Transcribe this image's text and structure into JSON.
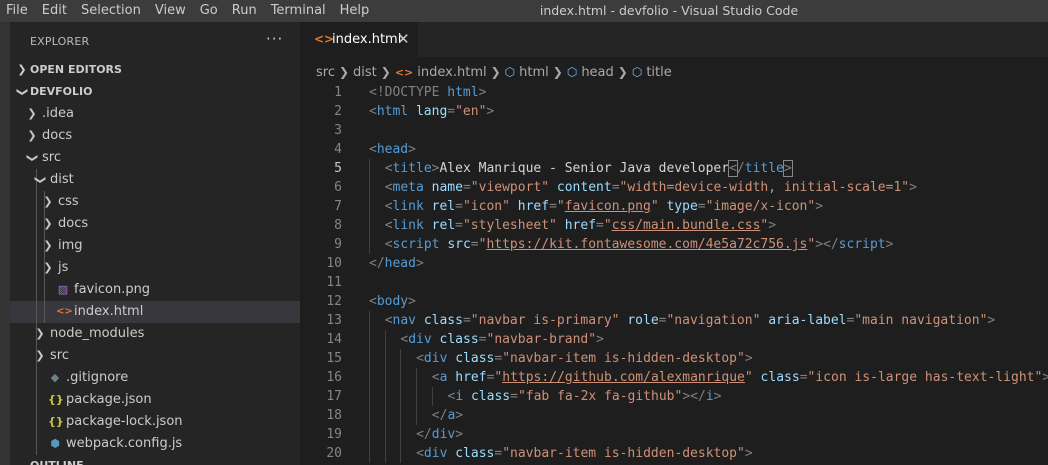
{
  "window": {
    "title": "index.html - devfolio - Visual Studio Code",
    "menu": [
      "File",
      "Edit",
      "Selection",
      "View",
      "Go",
      "Run",
      "Terminal",
      "Help"
    ]
  },
  "sidebar": {
    "title": "EXPLORER",
    "more": "···",
    "open_editors": "OPEN EDITORS",
    "project": "DEVFOLIO",
    "tree": [
      {
        "label": ".idea",
        "depth": 1,
        "kind": "folder",
        "expanded": false
      },
      {
        "label": "docs",
        "depth": 1,
        "kind": "folder",
        "expanded": false
      },
      {
        "label": "src",
        "depth": 1,
        "kind": "folder",
        "expanded": true
      },
      {
        "label": "dist",
        "depth": 2,
        "kind": "folder",
        "expanded": true
      },
      {
        "label": "css",
        "depth": 3,
        "kind": "folder",
        "expanded": false
      },
      {
        "label": "docs",
        "depth": 3,
        "kind": "folder",
        "expanded": false
      },
      {
        "label": "img",
        "depth": 3,
        "kind": "folder",
        "expanded": false
      },
      {
        "label": "js",
        "depth": 3,
        "kind": "folder",
        "expanded": false
      },
      {
        "label": "favicon.png",
        "depth": 3,
        "kind": "image"
      },
      {
        "label": "index.html",
        "depth": 3,
        "kind": "html",
        "selected": true
      },
      {
        "label": "node_modules",
        "depth": 2,
        "kind": "folder",
        "expanded": false
      },
      {
        "label": "src",
        "depth": 2,
        "kind": "folder",
        "expanded": false
      },
      {
        "label": ".gitignore",
        "depth": 2,
        "kind": "git"
      },
      {
        "label": "package.json",
        "depth": 2,
        "kind": "json"
      },
      {
        "label": "package-lock.json",
        "depth": 2,
        "kind": "json"
      },
      {
        "label": "webpack.config.js",
        "depth": 2,
        "kind": "webpack"
      }
    ],
    "outline_cut": "OUTLINE"
  },
  "editor": {
    "tab": {
      "label": "index.html",
      "close": "✕"
    },
    "breadcrumb": [
      "src",
      "dist",
      "index.html",
      "html",
      "head",
      "title"
    ],
    "lines": [
      {
        "n": "1",
        "indent": 0,
        "tokens": [
          [
            "t",
            "<!DOCTYPE "
          ],
          [
            "tag",
            "html"
          ],
          [
            "t",
            ">"
          ]
        ]
      },
      {
        "n": "2",
        "indent": 0,
        "tokens": [
          [
            "t",
            "<"
          ],
          [
            "tag",
            "html"
          ],
          [
            "t",
            " "
          ],
          [
            "attr",
            "lang"
          ],
          [
            "t",
            "="
          ],
          [
            "str",
            "\"en\""
          ],
          [
            "t",
            ">"
          ]
        ]
      },
      {
        "n": "3",
        "indent": 0,
        "tokens": []
      },
      {
        "n": "4",
        "indent": 0,
        "tokens": [
          [
            "t",
            "<"
          ],
          [
            "tag",
            "head"
          ],
          [
            "t",
            ">"
          ]
        ]
      },
      {
        "n": "5",
        "indent": 1,
        "current": true,
        "tokens": [
          [
            "t",
            "<"
          ],
          [
            "tag",
            "title"
          ],
          [
            "t",
            ">"
          ],
          [
            "txt",
            "Alex Manrique - Senior Java developer"
          ],
          [
            "hl",
            "<"
          ],
          [
            "t",
            "/"
          ],
          [
            "tag",
            "title"
          ],
          [
            "hl",
            ">"
          ]
        ]
      },
      {
        "n": "6",
        "indent": 1,
        "tokens": [
          [
            "t",
            "<"
          ],
          [
            "tag",
            "meta"
          ],
          [
            "t",
            " "
          ],
          [
            "attr",
            "name"
          ],
          [
            "t",
            "="
          ],
          [
            "str",
            "\"viewport\""
          ],
          [
            "t",
            " "
          ],
          [
            "attr",
            "content"
          ],
          [
            "t",
            "="
          ],
          [
            "str",
            "\"width=device-width, initial-scale=1\""
          ],
          [
            "t",
            ">"
          ]
        ]
      },
      {
        "n": "7",
        "indent": 1,
        "tokens": [
          [
            "t",
            "<"
          ],
          [
            "tag",
            "link"
          ],
          [
            "t",
            " "
          ],
          [
            "attr",
            "rel"
          ],
          [
            "t",
            "="
          ],
          [
            "str",
            "\"icon\""
          ],
          [
            "t",
            " "
          ],
          [
            "attr",
            "href"
          ],
          [
            "t",
            "="
          ],
          [
            "str",
            "\""
          ],
          [
            "link",
            "favicon.png"
          ],
          [
            "str",
            "\""
          ],
          [
            "t",
            " "
          ],
          [
            "attr",
            "type"
          ],
          [
            "t",
            "="
          ],
          [
            "str",
            "\"image/x-icon\""
          ],
          [
            "t",
            ">"
          ]
        ]
      },
      {
        "n": "8",
        "indent": 1,
        "tokens": [
          [
            "t",
            "<"
          ],
          [
            "tag",
            "link"
          ],
          [
            "t",
            " "
          ],
          [
            "attr",
            "rel"
          ],
          [
            "t",
            "="
          ],
          [
            "str",
            "\"stylesheet\""
          ],
          [
            "t",
            " "
          ],
          [
            "attr",
            "href"
          ],
          [
            "t",
            "="
          ],
          [
            "str",
            "\""
          ],
          [
            "link",
            "css/main.bundle.css"
          ],
          [
            "str",
            "\""
          ],
          [
            "t",
            ">"
          ]
        ]
      },
      {
        "n": "9",
        "indent": 1,
        "tokens": [
          [
            "t",
            "<"
          ],
          [
            "tag",
            "script"
          ],
          [
            "t",
            " "
          ],
          [
            "attr",
            "src"
          ],
          [
            "t",
            "="
          ],
          [
            "str",
            "\""
          ],
          [
            "link",
            "https://kit.fontawesome.com/4e5a72c756.js"
          ],
          [
            "str",
            "\""
          ],
          [
            "t",
            "></"
          ],
          [
            "tag",
            "script"
          ],
          [
            "t",
            ">"
          ]
        ]
      },
      {
        "n": "10",
        "indent": 0,
        "tokens": [
          [
            "t",
            "</"
          ],
          [
            "tag",
            "head"
          ],
          [
            "t",
            ">"
          ]
        ]
      },
      {
        "n": "11",
        "indent": 0,
        "tokens": []
      },
      {
        "n": "12",
        "indent": 0,
        "tokens": [
          [
            "t",
            "<"
          ],
          [
            "tag",
            "body"
          ],
          [
            "t",
            ">"
          ]
        ]
      },
      {
        "n": "13",
        "indent": 1,
        "tokens": [
          [
            "t",
            "<"
          ],
          [
            "tag",
            "nav"
          ],
          [
            "t",
            " "
          ],
          [
            "attr",
            "class"
          ],
          [
            "t",
            "="
          ],
          [
            "str",
            "\"navbar is-primary\""
          ],
          [
            "t",
            " "
          ],
          [
            "attr",
            "role"
          ],
          [
            "t",
            "="
          ],
          [
            "str",
            "\"navigation\""
          ],
          [
            "t",
            " "
          ],
          [
            "attr",
            "aria-label"
          ],
          [
            "t",
            "="
          ],
          [
            "str",
            "\"main navigation\""
          ],
          [
            "t",
            ">"
          ]
        ]
      },
      {
        "n": "14",
        "indent": 2,
        "tokens": [
          [
            "t",
            "<"
          ],
          [
            "tag",
            "div"
          ],
          [
            "t",
            " "
          ],
          [
            "attr",
            "class"
          ],
          [
            "t",
            "="
          ],
          [
            "str",
            "\"navbar-brand\""
          ],
          [
            "t",
            ">"
          ]
        ]
      },
      {
        "n": "15",
        "indent": 3,
        "tokens": [
          [
            "t",
            "<"
          ],
          [
            "tag",
            "div"
          ],
          [
            "t",
            " "
          ],
          [
            "attr",
            "class"
          ],
          [
            "t",
            "="
          ],
          [
            "str",
            "\"navbar-item is-hidden-desktop\""
          ],
          [
            "t",
            ">"
          ]
        ]
      },
      {
        "n": "16",
        "indent": 4,
        "tokens": [
          [
            "t",
            "<"
          ],
          [
            "tag",
            "a"
          ],
          [
            "t",
            " "
          ],
          [
            "attr",
            "href"
          ],
          [
            "t",
            "="
          ],
          [
            "str",
            "\""
          ],
          [
            "link",
            "https://github.com/alexmanrique"
          ],
          [
            "str",
            "\""
          ],
          [
            "t",
            " "
          ],
          [
            "attr",
            "class"
          ],
          [
            "t",
            "="
          ],
          [
            "str",
            "\"icon is-large has-text-light\""
          ],
          [
            "t",
            ">"
          ]
        ]
      },
      {
        "n": "17",
        "indent": 5,
        "tokens": [
          [
            "t",
            "<"
          ],
          [
            "tag",
            "i"
          ],
          [
            "t",
            " "
          ],
          [
            "attr",
            "class"
          ],
          [
            "t",
            "="
          ],
          [
            "str",
            "\"fab fa-2x fa-github\""
          ],
          [
            "t",
            "></"
          ],
          [
            "tag",
            "i"
          ],
          [
            "t",
            ">"
          ]
        ]
      },
      {
        "n": "18",
        "indent": 4,
        "tokens": [
          [
            "t",
            "</"
          ],
          [
            "tag",
            "a"
          ],
          [
            "t",
            ">"
          ]
        ]
      },
      {
        "n": "19",
        "indent": 3,
        "tokens": [
          [
            "t",
            "</"
          ],
          [
            "tag",
            "div"
          ],
          [
            "t",
            ">"
          ]
        ]
      },
      {
        "n": "20",
        "indent": 3,
        "tokens": [
          [
            "t",
            "<"
          ],
          [
            "tag",
            "div"
          ],
          [
            "t",
            " "
          ],
          [
            "attr",
            "class"
          ],
          [
            "t",
            "="
          ],
          [
            "str",
            "\"navbar-item is-hidden-desktop\""
          ],
          [
            "t",
            ">"
          ]
        ]
      }
    ]
  },
  "colors": {
    "tag": "#569cd6",
    "attr": "#9cdcfe",
    "string": "#ce9178",
    "punct": "#808080",
    "text": "#d4d4d4",
    "html_icon": "#e37933",
    "json_icon": "#cbcb41",
    "image_icon": "#a074c4",
    "webpack_icon": "#519aba",
    "selection": "#37373d"
  }
}
